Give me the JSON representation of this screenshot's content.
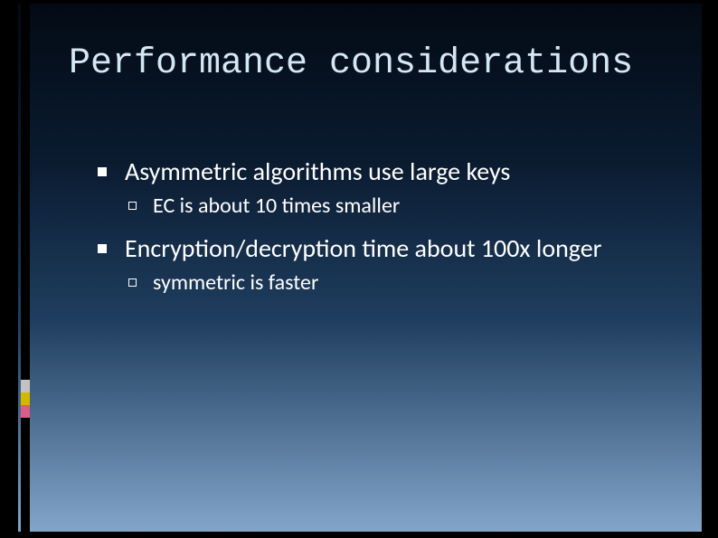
{
  "slide": {
    "title": "Performance considerations",
    "bullets": [
      {
        "text": "Asymmetric algorithms use large keys",
        "sub": [
          {
            "text": "EC is about 10 times smaller"
          }
        ]
      },
      {
        "text": "Encryption/decryption time about 100x longer",
        "sub": [
          {
            "text": "symmetric is faster"
          }
        ]
      }
    ]
  }
}
